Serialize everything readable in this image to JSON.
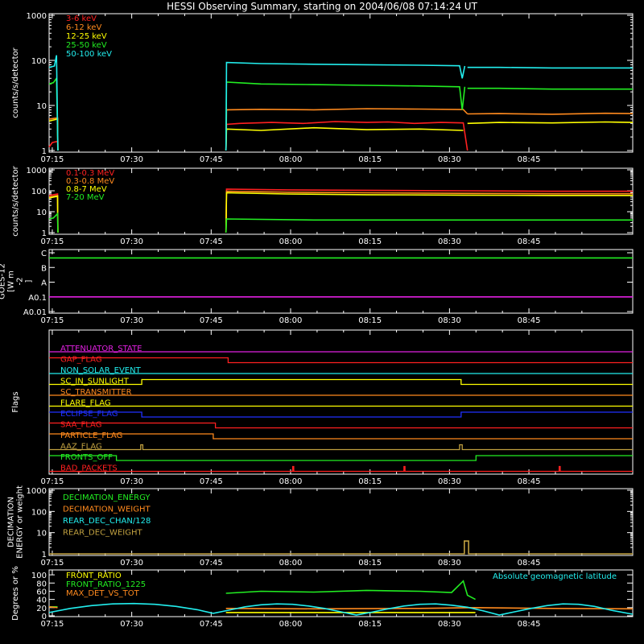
{
  "title": "HESSI Observing Summary, starting on 2004/06/08 07:14:24 UT",
  "time_ticks": [
    "07:15",
    "07:30",
    "07:45",
    "08:00",
    "08:15",
    "08:30",
    "08:45"
  ],
  "colors": {
    "red": "#ff2020",
    "orange": "#ff8a1e",
    "yellow": "#ffff00",
    "green": "#22ee22",
    "cyan": "#22eeee",
    "magenta": "#e020e0",
    "blue": "#2030ff",
    "olive": "#c0a040",
    "white": "#ffffff",
    "darkgreen": "#209020"
  },
  "chart_data": [
    {
      "type": "line",
      "ylabel": "counts/s/detector",
      "y_scale": "log",
      "ylim": [
        1,
        1000
      ],
      "y_ticks": [
        "1",
        "10",
        "100",
        "1000"
      ],
      "series": [
        {
          "name": "3-6 keV",
          "color": "#ff2020",
          "segments": [
            {
              "t": [
                0,
                0.6,
                1.6,
                1.65
              ],
              "y": [
                1.2,
                1.5,
                1.6,
                1.0
              ]
            },
            {
              "t": [
                33.4,
                33.5,
                36,
                42,
                48,
                54,
                60,
                64,
                69,
                74,
                78.2,
                79
              ],
              "y": [
                1.0,
                3.8,
                4.0,
                4.2,
                4.0,
                4.4,
                4.2,
                4.3,
                4.0,
                4.2,
                4.1,
                1.0
              ]
            }
          ]
        },
        {
          "name": "6-12 keV",
          "color": "#ff8a1e",
          "segments": [
            {
              "t": [
                0,
                1.6,
                1.65
              ],
              "y": [
                5.0,
                5.3,
                1.0
              ]
            },
            {
              "t": [
                33.4,
                33.5,
                40,
                50,
                60,
                70,
                78.2,
                79
              ],
              "y": [
                1.0,
                8.0,
                8.2,
                8.0,
                8.5,
                8.3,
                8.1,
                6.5
              ]
            },
            {
              "t": [
                79,
                85,
                95,
                105,
                110.2
              ],
              "y": [
                6.5,
                6.6,
                6.4,
                6.7,
                6.6
              ]
            }
          ]
        },
        {
          "name": "12-25 keV",
          "color": "#ffff00",
          "segments": [
            {
              "t": [
                0,
                1.6,
                1.65
              ],
              "y": [
                4.5,
                5.0,
                1.0
              ]
            },
            {
              "t": [
                33.4,
                33.5,
                40,
                50,
                60,
                70,
                78.2
              ],
              "y": [
                1.0,
                3.0,
                2.8,
                3.2,
                2.9,
                3.0,
                2.8
              ]
            },
            {
              "t": [
                79,
                85,
                95,
                105,
                110.2
              ],
              "y": [
                4.0,
                4.2,
                4.1,
                4.3,
                4.2
              ]
            }
          ]
        },
        {
          "name": "25-50 keV",
          "color": "#22ee22",
          "segments": [
            {
              "t": [
                0,
                0.8,
                1.4,
                1.65
              ],
              "y": [
                30,
                32,
                40,
                1.0
              ]
            },
            {
              "t": [
                33.4,
                33.5,
                40,
                50,
                60,
                70,
                77.5,
                78.0,
                78.5
              ],
              "y": [
                1.0,
                33,
                30,
                29,
                28,
                27,
                26,
                8,
                26
              ]
            },
            {
              "t": [
                79,
                85,
                95,
                105,
                110.2
              ],
              "y": [
                24,
                24,
                23,
                23,
                23
              ]
            }
          ]
        },
        {
          "name": "50-100 keV",
          "color": "#22eeee",
          "segments": [
            {
              "t": [
                0,
                1,
                1.4,
                1.65
              ],
              "y": [
                70,
                75,
                130,
                1.0
              ]
            },
            {
              "t": [
                33.4,
                33.5,
                40,
                50,
                60,
                70,
                77.5,
                78.0,
                78.5
              ],
              "y": [
                1.0,
                90,
                85,
                82,
                80,
                78,
                76,
                40,
                75
              ]
            },
            {
              "t": [
                79,
                85,
                95,
                105,
                110.2
              ],
              "y": [
                70,
                70,
                68,
                68,
                68
              ]
            }
          ]
        }
      ]
    },
    {
      "type": "line",
      "ylabel": "counts/s/detector",
      "y_scale": "log",
      "ylim": [
        1,
        1000
      ],
      "y_ticks": [
        "1",
        "10",
        "100",
        "1000"
      ],
      "series": [
        {
          "name": "0.1-0.3 MeV",
          "color": "#ff2020",
          "segments": [
            {
              "t": [
                0,
                1.6,
                1.65
              ],
              "y": [
                60,
                70,
                1.0
              ]
            },
            {
              "t": [
                33.4,
                33.5,
                45,
                60,
                78,
                95,
                110.2
              ],
              "y": [
                1.0,
                120,
                110,
                105,
                100,
                95,
                95
              ]
            }
          ]
        },
        {
          "name": "0.3-0.8 MeV",
          "color": "#ff8a1e",
          "segments": [
            {
              "t": [
                0,
                1.6,
                1.65
              ],
              "y": [
                50,
                60,
                1.0
              ]
            },
            {
              "t": [
                33.4,
                33.5,
                45,
                60,
                78,
                95,
                110.2
              ],
              "y": [
                1.0,
                95,
                85,
                80,
                75,
                72,
                72
              ]
            }
          ]
        },
        {
          "name": "0.8-7 MeV",
          "color": "#ffff00",
          "segments": [
            {
              "t": [
                0,
                1.6,
                1.65
              ],
              "y": [
                45,
                55,
                1.0
              ]
            },
            {
              "t": [
                33.4,
                33.5,
                45,
                60,
                78,
                95,
                110.2
              ],
              "y": [
                1.0,
                80,
                70,
                65,
                62,
                60,
                60
              ]
            }
          ]
        },
        {
          "name": "7-20 MeV",
          "color": "#22ee22",
          "segments": [
            {
              "t": [
                0,
                0.8,
                1.6,
                1.65
              ],
              "y": [
                4.5,
                5.0,
                8.0,
                1.0
              ]
            },
            {
              "t": [
                33.4,
                33.5,
                50,
                70,
                90,
                110.2
              ],
              "y": [
                1.0,
                4.5,
                4.0,
                4.0,
                4.0,
                4.0
              ]
            }
          ]
        }
      ]
    },
    {
      "type": "line",
      "ylabel": "GOES-12 [W m^-2]",
      "ylabel_lines": [
        "GOES-12",
        "[W m",
        "-2",
        "]"
      ],
      "y_ticks": [
        "A0.01",
        "A0.1",
        "A",
        "B",
        "C"
      ],
      "series": [
        {
          "name": "",
          "color": "#22ee22",
          "segments": [
            {
              "t": [
                0,
                110.2
              ],
              "y": [
                3.65,
                3.65
              ]
            }
          ]
        },
        {
          "name": "",
          "color": "#e020e0",
          "segments": [
            {
              "t": [
                0,
                110.2
              ],
              "y": [
                1.0,
                1.0
              ]
            }
          ]
        }
      ]
    },
    {
      "type": "line",
      "ylabel": "Flags",
      "flags": [
        {
          "label": "ATTENUATOR_STATE",
          "color": "#e020e0",
          "steps": [
            [
              0,
              0
            ],
            [
              110.2,
              0
            ]
          ]
        },
        {
          "label": "GAP_FLAG",
          "color": "#ff2020",
          "steps": [
            [
              0,
              1
            ],
            [
              33.8,
              0
            ],
            [
              110.2,
              0
            ]
          ]
        },
        {
          "label": "NON_SOLAR_EVENT",
          "color": "#22eeee",
          "steps": [
            [
              0,
              0
            ],
            [
              110.2,
              0
            ]
          ]
        },
        {
          "label": "SC_IN_SUNLIGHT",
          "color": "#ffff00",
          "steps": [
            [
              0,
              0
            ],
            [
              17.5,
              1
            ],
            [
              77.8,
              0
            ],
            [
              110.2,
              0
            ]
          ]
        },
        {
          "label": "SC_TRANSMITTER",
          "color": "#ff8a1e",
          "steps": [
            [
              0,
              0
            ],
            [
              110.2,
              0
            ]
          ]
        },
        {
          "label": "FLARE_FLAG",
          "color": "#ffff00",
          "steps": [
            [
              0,
              0
            ],
            [
              110.2,
              0
            ]
          ]
        },
        {
          "label": "ECLIPSE_FLAG",
          "color": "#2030ff",
          "steps": [
            [
              0,
              1
            ],
            [
              17.5,
              0
            ],
            [
              77.8,
              1
            ],
            [
              110.2,
              1
            ]
          ]
        },
        {
          "label": "SAA_FLAG",
          "color": "#ff2020",
          "steps": [
            [
              0,
              1
            ],
            [
              31.4,
              0
            ],
            [
              110.2,
              0
            ]
          ]
        },
        {
          "label": "PARTICLE_FLAG",
          "color": "#ff8a1e",
          "steps": [
            [
              0,
              1
            ],
            [
              31.0,
              0
            ],
            [
              110.2,
              0
            ]
          ]
        },
        {
          "label": "AAZ_FLAG",
          "color": "#c0a040",
          "steps": [
            [
              0,
              0
            ],
            [
              17.3,
              1
            ],
            [
              17.7,
              0
            ],
            [
              77.5,
              1
            ],
            [
              78.0,
              0
            ],
            [
              110.2,
              0
            ]
          ]
        },
        {
          "label": "FRONTS_OFF",
          "color": "#22ee22",
          "steps": [
            [
              0,
              1
            ],
            [
              12.7,
              0
            ],
            [
              80.6,
              1
            ],
            [
              110.2,
              1
            ]
          ]
        },
        {
          "label": "BAD_PACKETS",
          "color": "#ff2020",
          "steps": [
            [
              0,
              0
            ],
            [
              46.0,
              1
            ],
            [
              46.2,
              0
            ],
            [
              67.0,
              1
            ],
            [
              67.2,
              0
            ],
            [
              96.3,
              1
            ],
            [
              96.5,
              0
            ],
            [
              110.2,
              0
            ]
          ]
        }
      ]
    },
    {
      "type": "line",
      "ylabel": "DECIMATION ENERGY or weight",
      "ylabel_lines": [
        "DECIMATION",
        "ENERGY or weight"
      ],
      "y_scale": "log",
      "ylim": [
        1,
        1000
      ],
      "y_ticks": [
        "1",
        "10",
        "100",
        "1000"
      ],
      "series": [
        {
          "name": "DECIMATION_ENERGY",
          "color": "#22ee22",
          "segments": []
        },
        {
          "name": "DECIMATION_WEIGHT",
          "color": "#ff8a1e",
          "segments": []
        },
        {
          "name": "REAR_DEC_CHAN/128",
          "color": "#22eeee",
          "segments": []
        },
        {
          "name": "REAR_DEC_WEIGHT",
          "color": "#c0a040",
          "segments": [
            {
              "t": [
                0,
                78.4,
                78.4,
                79.2,
                79.2,
                110.2
              ],
              "y": [
                1,
                1,
                4,
                4,
                1,
                1
              ]
            }
          ]
        }
      ]
    },
    {
      "type": "line",
      "ylabel": "Degrees or %",
      "ylim": [
        0,
        110
      ],
      "y_ticks": [
        "0",
        "20",
        "40",
        "60",
        "80",
        "100"
      ],
      "annotation": "Absolute geomagnetic latitude",
      "series": [
        {
          "name": "FRONT_RATIO",
          "color": "#ffff00",
          "segments": [
            {
              "t": [
                33.4,
                50,
                70,
                80.5
              ],
              "y": [
                8,
                8,
                8,
                8
              ]
            }
          ]
        },
        {
          "name": "FRONT_RATIO_1225",
          "color": "#22ee22",
          "segments": [
            {
              "t": [
                0,
                1.6
              ],
              "y": [
                22,
                22
              ]
            },
            {
              "t": [
                33.4,
                40,
                50,
                60,
                70,
                76,
                78.2,
                79,
                80.5
              ],
              "y": [
                55,
                60,
                58,
                62,
                60,
                57,
                85,
                50,
                40
              ]
            }
          ]
        },
        {
          "name": "MAX_DET_VS_TOT",
          "color": "#ff8a1e",
          "segments": [
            {
              "t": [
                0,
                1.6
              ],
              "y": [
                22,
                20
              ]
            },
            {
              "t": [
                33.4,
                50,
                70,
                80.5,
                95,
                110.2
              ],
              "y": [
                18,
                17,
                18,
                20,
                18,
                17
              ]
            }
          ]
        },
        {
          "name": "",
          "color": "#22eeee",
          "segments": [
            {
              "t": [
                0,
                4,
                8,
                12,
                16,
                20,
                24,
                28,
                31,
                34,
                37,
                40,
                43,
                46,
                49,
                52,
                55,
                58,
                61,
                64,
                67,
                70,
                73,
                76,
                79,
                82,
                85,
                88,
                91,
                94,
                97,
                100,
                103,
                106,
                110.2
              ],
              "y": [
                8,
                18,
                25,
                29,
                30,
                28,
                23,
                15,
                6,
                14,
                22,
                27,
                29,
                28,
                24,
                18,
                10,
                2,
                9,
                17,
                24,
                28,
                29,
                26,
                21,
                12,
                2,
                10,
                18,
                25,
                29,
                28,
                23,
                14,
                4
              ]
            }
          ]
        }
      ]
    }
  ]
}
